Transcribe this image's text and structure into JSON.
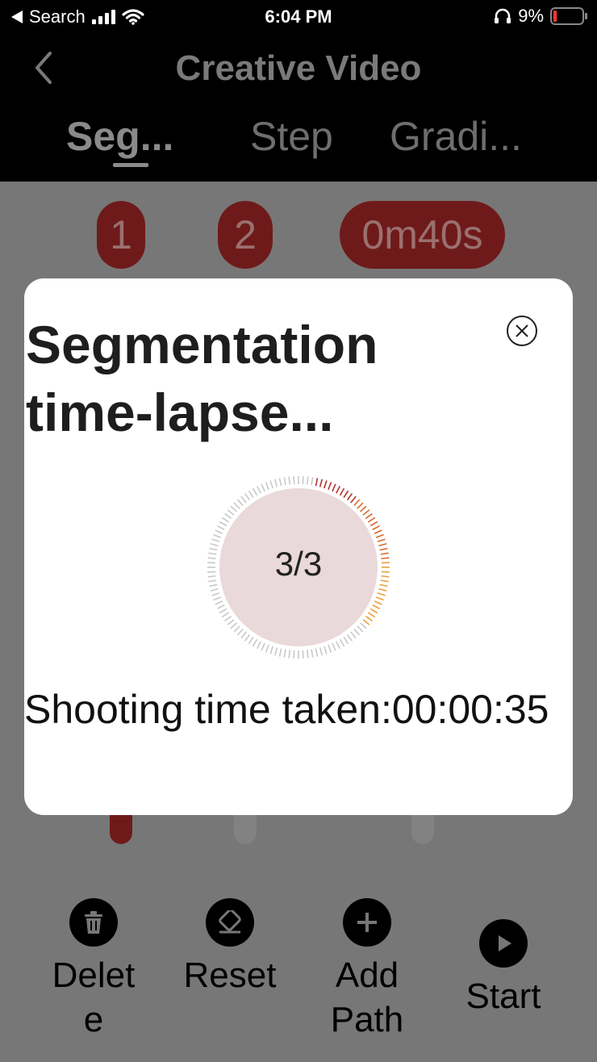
{
  "status_bar": {
    "back_app": "Search",
    "time": "6:04 PM",
    "battery": "9%"
  },
  "header": {
    "title": "Creative Video",
    "tabs": [
      {
        "label": "Seg...",
        "active": true
      },
      {
        "label": "Step",
        "active": false
      },
      {
        "label": "Gradi...",
        "active": false
      }
    ]
  },
  "background": {
    "pills": [
      "1",
      "2",
      "0m40s"
    ],
    "actions": [
      {
        "label": "Delete",
        "icon": "trash-icon"
      },
      {
        "label": "Reset",
        "icon": "eraser-icon"
      },
      {
        "label": "Add Path",
        "icon": "plus-icon"
      },
      {
        "label": "Start",
        "icon": "play-icon"
      }
    ],
    "colors": {
      "accent_red": "#6f1a1a",
      "overlay": "#777777"
    }
  },
  "modal": {
    "title": "Segmentation time-lapse...",
    "progress_text": "3/3",
    "shooting_label": "Shooting time taken:00:00:35"
  }
}
